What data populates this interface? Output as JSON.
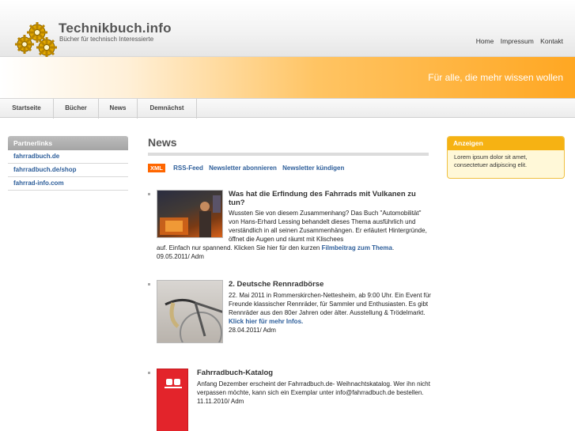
{
  "site": {
    "title": "Technikbuch.info",
    "subtitle": "Bücher für technisch Interessierte",
    "tagline": "Für alle, die mehr wissen wollen"
  },
  "topnav": [
    "Home",
    "Impressum",
    "Kontakt"
  ],
  "mainnav": [
    "Startseite",
    "Bücher",
    "News",
    "Demnächst"
  ],
  "sidebar": {
    "heading": "Partnerlinks",
    "links": [
      "fahrradbuch.de",
      "fahrradbuch.de/shop",
      "fahrrad-info.com"
    ]
  },
  "news": {
    "heading": "News",
    "feed": {
      "badge": "XML",
      "links": [
        "RSS-Feed",
        "Newsletter abonnieren",
        "Newsletter kündigen"
      ]
    },
    "items": [
      {
        "title": "Was hat die Erfindung des Fahrrads mit Vulkanen zu tun?",
        "body": "Wussten Sie von diesem Zusammenhang? Das Buch \"Automobilität\" von Hans-Erhard Lessing behandelt dieses Thema ausführlich und verständlich in all seinen Zusammenhängen. Er erläutert Hintergründe, öffnet die Augen und räumt mit Klischees auf. Einfach nur spannend. Klicken Sie hier für den kurzen",
        "link": "Filmbeitrag zum Thema",
        "after_link": ".",
        "date": "09.05.2011/ Adm"
      },
      {
        "title": "2. Deutsche Rennradbörse",
        "body": "22. Mai 2011 in Rommerskirchen-Nettesheim, ab 9:00 Uhr. Ein Event für Freunde klassischer Rennräder, für Sammler und Enthusiasten. Es gibt Rennräder aus den 80er Jahren oder älter. Ausstellung & Trödelmarkt.",
        "link": "Klick hier für mehr Infos.",
        "date": "28.04.2011/ Adm"
      },
      {
        "title": "Fahrradbuch-Katalog",
        "body": "Anfang Dezember erscheint der Fahrradbuch.de- Weihnachtskatalog. Wer ihn nicht verpassen möchte, kann sich ein Exemplar unter info@fahrradbuch.de bestellen.",
        "date": "11.11.2010/ Adm"
      }
    ]
  },
  "ads": {
    "heading": "Anzeigen",
    "text": "Lorem ipsum dolor sit amet, consectetuer adipiscing elit."
  },
  "colors": {
    "accent": "#ffa722",
    "link": "#2d5e9a",
    "ad_header": "#f6b213",
    "catalog_red": "#e3242b"
  }
}
